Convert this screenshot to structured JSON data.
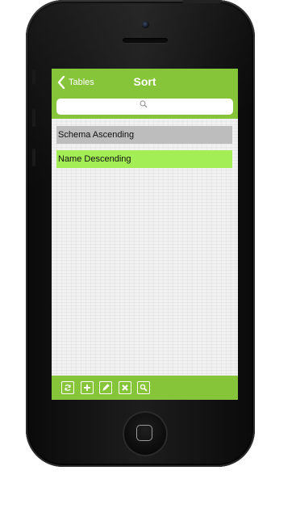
{
  "navbar": {
    "back_label": "Tables",
    "title": "Sort"
  },
  "search": {
    "placeholder": ""
  },
  "sort_items": [
    {
      "label": "Schema Ascending",
      "state": "normal"
    },
    {
      "label": "Name Descending",
      "state": "selected"
    }
  ],
  "toolbar": {
    "buttons": [
      "refresh-icon",
      "add-icon",
      "edit-icon",
      "delete-icon",
      "search-icon"
    ]
  },
  "colors": {
    "accent": "#86c43a",
    "selected_row": "#a4ee55",
    "normal_row": "#bdbdbd"
  }
}
